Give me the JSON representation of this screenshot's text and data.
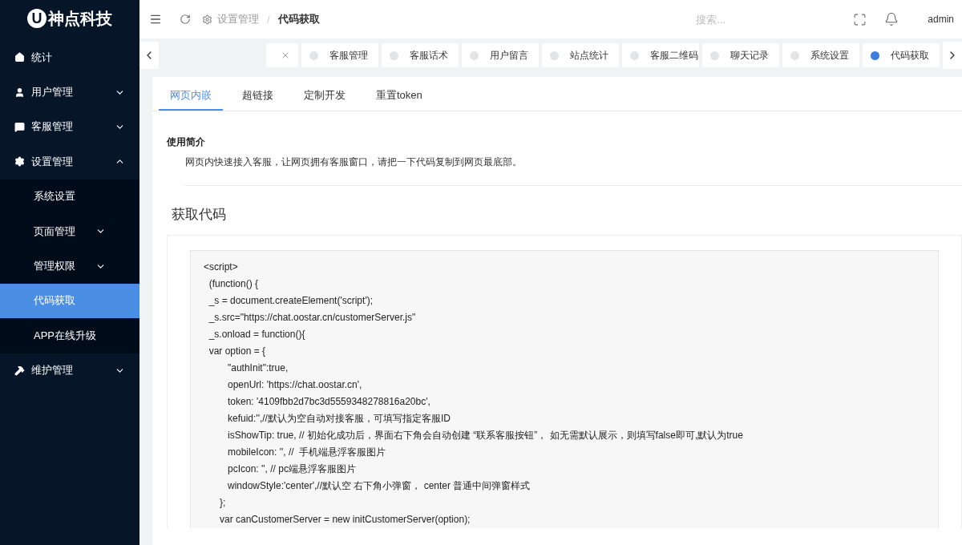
{
  "logo": {
    "mark": "U",
    "name": "神点科技"
  },
  "sidebar": {
    "items": [
      {
        "label": "统计",
        "kind": "home",
        "selected": false
      },
      {
        "label": "用户管理",
        "kind": "user",
        "expanded": false,
        "selected": false
      },
      {
        "label": "客服管理",
        "kind": "chat",
        "expanded": false,
        "selected": false
      },
      {
        "label": "设置管理",
        "kind": "gear",
        "expanded": true,
        "selected": false,
        "children": [
          {
            "label": "系统设置",
            "selected": false
          },
          {
            "label": "页面管理",
            "selected": false,
            "expanded": false
          },
          {
            "label": "管理权限",
            "selected": false,
            "expanded": false
          },
          {
            "label": "代码获取",
            "selected": true
          },
          {
            "label": "APP在线升级",
            "selected": false
          }
        ]
      },
      {
        "label": "维护管理",
        "kind": "hammer",
        "expanded": false,
        "selected": false
      }
    ]
  },
  "header": {
    "breadcrumb": [
      "设置管理",
      "代码获取"
    ],
    "separator": "/",
    "search": {
      "placeholder": "搜索..."
    },
    "user": "admin"
  },
  "cut_tab": {
    "kind": "cut"
  },
  "page_tabs": [
    {
      "label": "客服管理",
      "selected": false
    },
    {
      "label": "客服话术",
      "selected": false
    },
    {
      "label": "用户留言",
      "selected": false
    },
    {
      "label": "站点统计",
      "selected": false
    },
    {
      "label": "客服二维码",
      "selected": false
    },
    {
      "label": "聊天记录",
      "selected": false
    },
    {
      "label": "系统设置",
      "selected": false
    },
    {
      "label": "代码获取",
      "selected": true
    }
  ],
  "content_tabs": [
    {
      "label": "网页内嵌",
      "selected": true
    },
    {
      "label": "超链接",
      "selected": false
    },
    {
      "label": "定制开发",
      "selected": false
    },
    {
      "label": "重置token",
      "selected": false
    }
  ],
  "intro": {
    "title": "使用简介",
    "text": "网页内快速接入客服，让网页拥有客服窗口，请把一下代码复制到网页最底部。"
  },
  "code_section": {
    "title": "获取代码",
    "lines": [
      "<script>",
      "  (function() {",
      "  _s = document.createElement('script');",
      "  _s.src=\"https://chat.oostar.cn/customerServer.js\"",
      "  _s.onload = function(){",
      "  var option = {",
      "         \"authInit\":true,",
      "         openUrl: 'https://chat.oostar.cn',",
      "         token: '4109fbb2d7bc3d5559348278816a20bc',",
      "         kefuid:'',//默认为空自动对接客服，可填写指定客服ID",
      "         isShowTip: true, // 初始化成功后，界面右下角会自动创建 “联系客服按钮”， 如无需默认展示，则填写false即可,默认为true",
      "         mobileIcon: '', //  手机端悬浮客服图片",
      "         pcIcon: '', // pc端悬浮客服图片",
      "         windowStyle:'center',//默认空 右下角小弹窗， center 普通中间弹窗样式",
      "      };",
      "      var canCustomerServer = new initCustomerServer(option);"
    ]
  }
}
